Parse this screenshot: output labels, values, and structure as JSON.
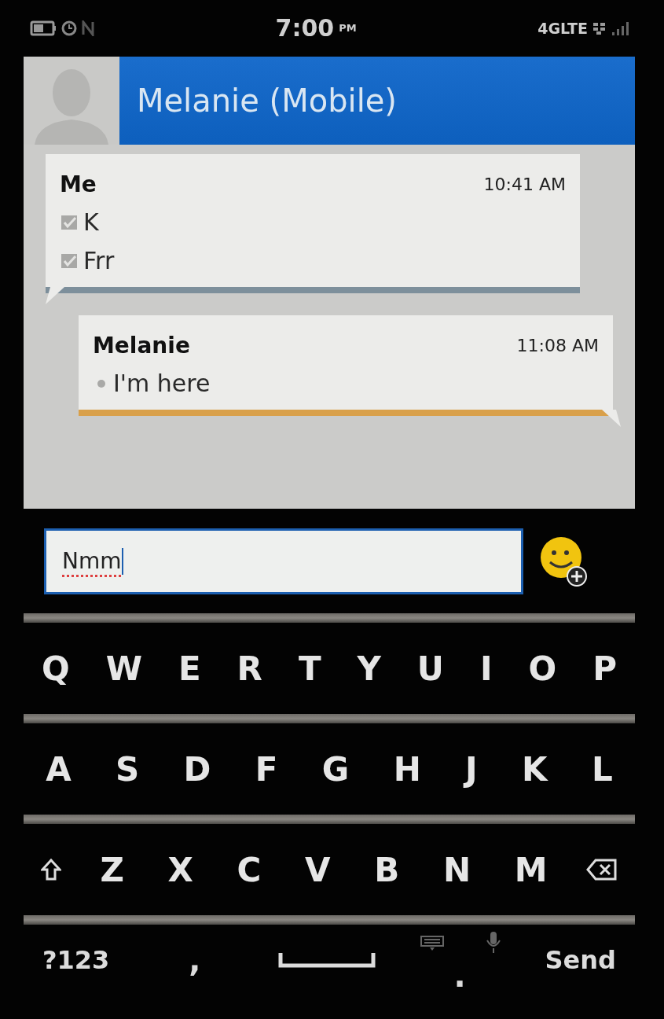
{
  "status_bar": {
    "time": "7:00",
    "meridiem": "PM",
    "network": "4GLTE"
  },
  "header": {
    "title": "Melanie (Mobile)"
  },
  "messages": [
    {
      "kind": "sent",
      "sender": "Me",
      "time": "10:41 AM",
      "lines": [
        {
          "text": "K",
          "delivered": true
        },
        {
          "text": "Frr",
          "delivered": true
        }
      ]
    },
    {
      "kind": "received",
      "sender": "Melanie",
      "time": "11:08 AM",
      "lines": [
        {
          "text": "I'm here",
          "delivered": false
        }
      ]
    }
  ],
  "composer": {
    "value": "Nmm"
  },
  "keyboard": {
    "rows": [
      {
        "keys": [
          {
            "kind": "letter",
            "label": "Q"
          },
          {
            "kind": "letter",
            "label": "W"
          },
          {
            "kind": "letter",
            "label": "E"
          },
          {
            "kind": "letter",
            "label": "R"
          },
          {
            "kind": "letter",
            "label": "T"
          },
          {
            "kind": "letter",
            "label": "Y"
          },
          {
            "kind": "letter",
            "label": "U"
          },
          {
            "kind": "letter",
            "label": "I"
          },
          {
            "kind": "letter",
            "label": "O"
          },
          {
            "kind": "letter",
            "label": "P"
          }
        ]
      },
      {
        "keys": [
          {
            "kind": "letter",
            "label": "A"
          },
          {
            "kind": "letter",
            "label": "S"
          },
          {
            "kind": "letter",
            "label": "D"
          },
          {
            "kind": "letter",
            "label": "F"
          },
          {
            "kind": "letter",
            "label": "G"
          },
          {
            "kind": "letter",
            "label": "H"
          },
          {
            "kind": "letter",
            "label": "J"
          },
          {
            "kind": "letter",
            "label": "K"
          },
          {
            "kind": "letter",
            "label": "L"
          }
        ]
      },
      {
        "keys": [
          {
            "kind": "shift"
          },
          {
            "kind": "letter",
            "label": "Z"
          },
          {
            "kind": "letter",
            "label": "X"
          },
          {
            "kind": "letter",
            "label": "C"
          },
          {
            "kind": "letter",
            "label": "V"
          },
          {
            "kind": "letter",
            "label": "B"
          },
          {
            "kind": "letter",
            "label": "N"
          },
          {
            "kind": "letter",
            "label": "M"
          },
          {
            "kind": "backspace"
          }
        ]
      }
    ],
    "bottom_row": [
      {
        "kind": "symbols",
        "label": "?123"
      },
      {
        "kind": "letter",
        "label": ","
      },
      {
        "kind": "space"
      },
      {
        "kind": "period",
        "label": "."
      },
      {
        "kind": "send",
        "label": "Send"
      }
    ]
  }
}
